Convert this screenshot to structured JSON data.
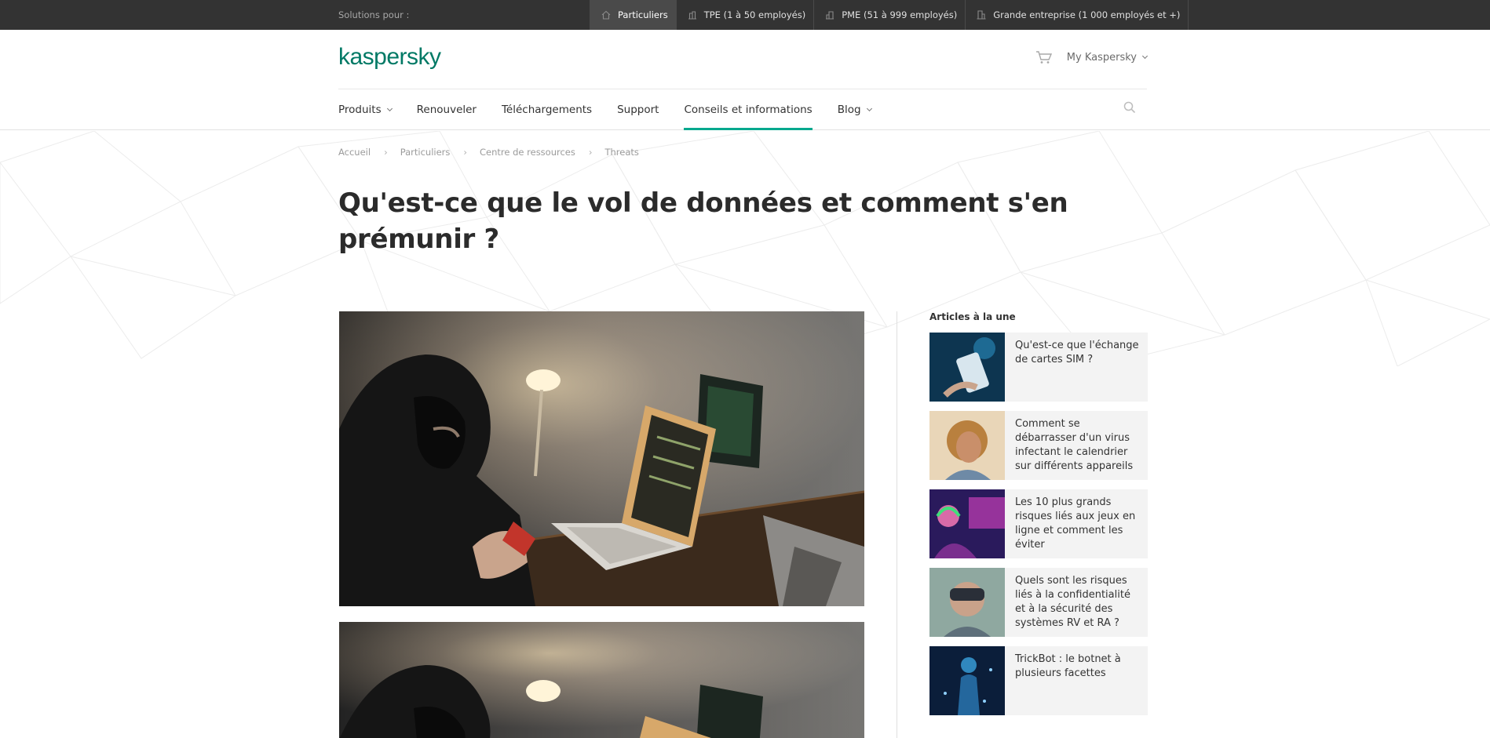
{
  "topbar": {
    "solutions_label": "Solutions pour :",
    "segments": [
      {
        "label": "Particuliers",
        "icon": "home-icon"
      },
      {
        "label": "TPE (1 à 50 employés)",
        "icon": "small-building-icon"
      },
      {
        "label": "PME (51 à 999 employés)",
        "icon": "building-icon"
      },
      {
        "label": "Grande entreprise (1 000 employés et +)",
        "icon": "enterprise-icon"
      }
    ],
    "active_segment": "Particuliers"
  },
  "header": {
    "logo": "kaspersky",
    "my_kaspersky": "My Kaspersky",
    "cart_icon": "cart-icon",
    "search_icon": "search-icon"
  },
  "nav": {
    "items": [
      {
        "label": "Produits",
        "dropdown": true
      },
      {
        "label": "Renouveler",
        "dropdown": false
      },
      {
        "label": "Téléchargements",
        "dropdown": false
      },
      {
        "label": "Support",
        "dropdown": false
      },
      {
        "label": "Conseils et informations",
        "dropdown": false,
        "active": true
      },
      {
        "label": "Blog",
        "dropdown": true
      }
    ]
  },
  "breadcrumb": [
    "Accueil",
    "Particuliers",
    "Centre de ressources",
    "Threats"
  ],
  "article": {
    "title": "Qu'est-ce que le vol de données et comment s'en prémunir ?"
  },
  "sidebar": {
    "title": "Articles à la une",
    "cards": [
      {
        "text": "Qu'est-ce que l'échange de cartes SIM ?"
      },
      {
        "text": "Comment se débarrasser d'un virus infectant le calendrier sur différents appareils"
      },
      {
        "text": "Les 10 plus grands risques liés aux jeux en ligne et comment les éviter"
      },
      {
        "text": "Quels sont les risques liés à la confidentialité et à la sécurité des systèmes RV et RA ?"
      },
      {
        "text": "TrickBot : le botnet à plusieurs facettes"
      }
    ]
  },
  "colors": {
    "brand": "#007965",
    "accent": "#00a88e",
    "topbar": "#333333"
  }
}
